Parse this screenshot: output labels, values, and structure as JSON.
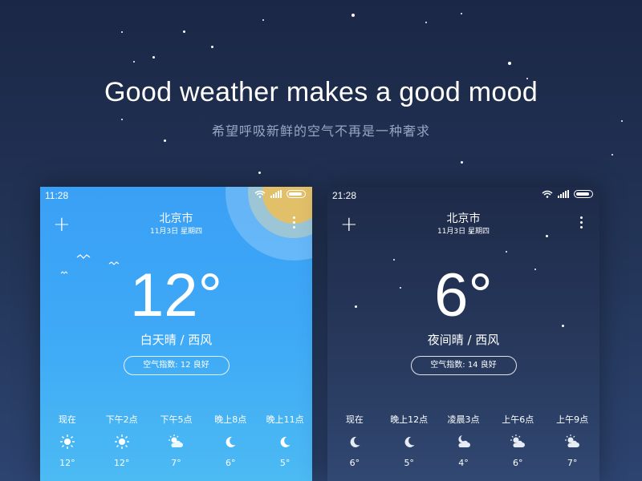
{
  "hero": {
    "title": "Good weather makes a good mood",
    "subtitle": "希望呼吸新鲜的空气不再是一种奢求"
  },
  "day_screen": {
    "time": "11:28",
    "city": "北京市",
    "date": "11月3日 星期四",
    "temperature": "12°",
    "condition": "白天晴 / 西风",
    "aqi": "空气指数: 12 良好",
    "hourly": [
      {
        "label": "现在",
        "icon": "sun-icon",
        "temp": "12°"
      },
      {
        "label": "下午2点",
        "icon": "sun-icon",
        "temp": "12°"
      },
      {
        "label": "下午5点",
        "icon": "partly-cloudy-icon",
        "temp": "7°"
      },
      {
        "label": "晚上8点",
        "icon": "moon-icon",
        "temp": "6°"
      },
      {
        "label": "晚上11点",
        "icon": "moon-icon",
        "temp": "5°"
      }
    ]
  },
  "night_screen": {
    "time": "21:28",
    "city": "北京市",
    "date": "11月3日 星期四",
    "temperature": "6°",
    "condition": "夜间晴 / 西风",
    "aqi": "空气指数: 14 良好",
    "hourly": [
      {
        "label": "现在",
        "icon": "moon-icon",
        "temp": "6°"
      },
      {
        "label": "晚上12点",
        "icon": "moon-icon",
        "temp": "5°"
      },
      {
        "label": "凌晨3点",
        "icon": "cloud-moon-icon",
        "temp": "4°"
      },
      {
        "label": "上午6点",
        "icon": "partly-cloudy-icon",
        "temp": "6°"
      },
      {
        "label": "上午9点",
        "icon": "partly-cloudy-icon",
        "temp": "7°"
      }
    ]
  },
  "colors": {
    "background": "#1b2746",
    "day_sky": "#3aa0f5",
    "night_sky": "#1e2a49",
    "sun": "#e2c06a"
  }
}
